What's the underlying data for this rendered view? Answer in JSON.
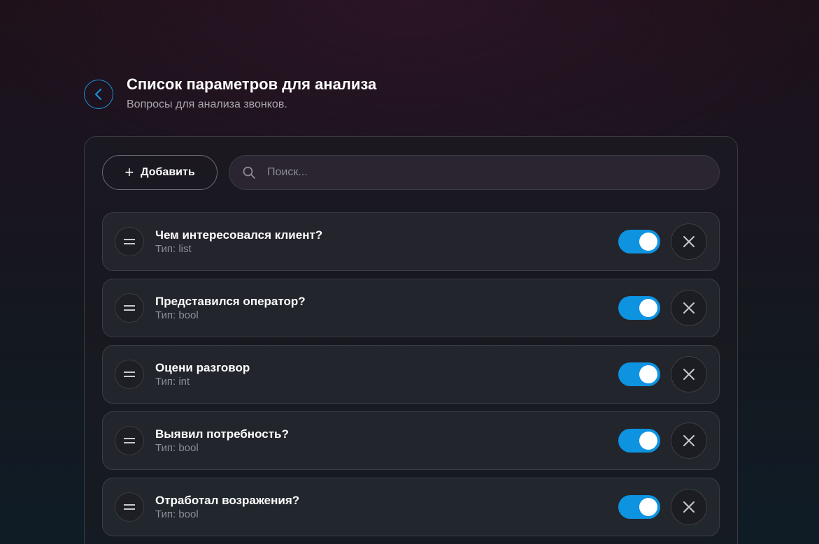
{
  "header": {
    "title": "Список параметров для анализа",
    "subtitle": "Вопросы для анализа звонков."
  },
  "toolbar": {
    "add_label": "Добавить",
    "search_placeholder": "Поиск..."
  },
  "colors": {
    "accent": "#0d93e0",
    "back_border": "#1a8fd6"
  },
  "icons": {
    "back": "chevron-left-icon",
    "add": "plus-icon",
    "search": "search-icon",
    "drag": "drag-handle-icon",
    "remove": "close-icon"
  },
  "items": [
    {
      "title": "Чем интересовался клиент?",
      "type": "Тип: list",
      "enabled": true
    },
    {
      "title": "Представился оператор?",
      "type": "Тип: bool",
      "enabled": true
    },
    {
      "title": "Оцени разговор",
      "type": "Тип: int",
      "enabled": true
    },
    {
      "title": "Выявил потребность?",
      "type": "Тип: bool",
      "enabled": true
    },
    {
      "title": "Отработал возражения?",
      "type": "Тип: bool",
      "enabled": true
    }
  ]
}
